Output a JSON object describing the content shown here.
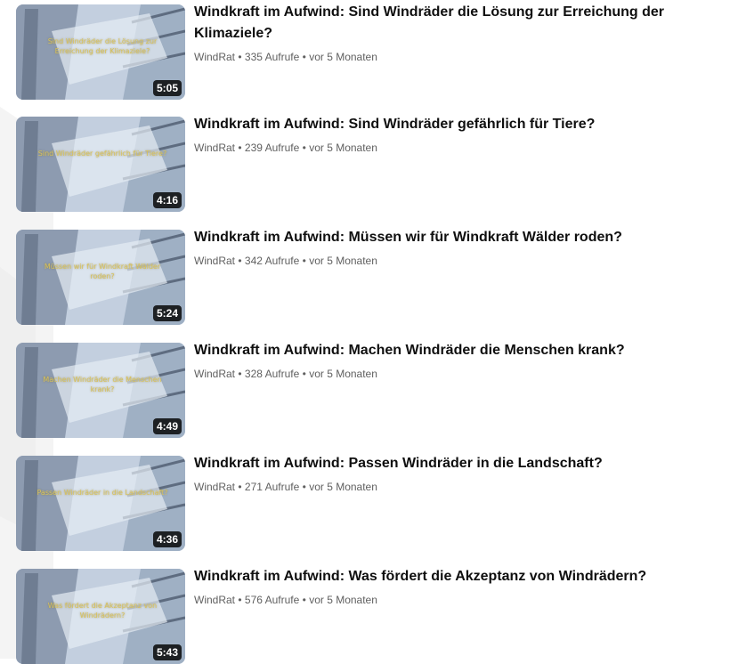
{
  "videos": [
    {
      "title": "Windkraft im Aufwind: Sind Windräder die Lösung zur Erreichung der Klimaziele?",
      "thumb_text": "Sind Windräder die Lösung zur Erreichung der Klimaziele?",
      "duration": "5:05",
      "channel": "WindRat",
      "sep1": "•",
      "views": "335 Aufrufe",
      "sep2": "•",
      "age": "vor 5 Monaten"
    },
    {
      "title": "Windkraft im Aufwind: Sind Windräder gefährlich für Tiere?",
      "thumb_text": "Sind Windräder gefährlich für Tiere?",
      "duration": "4:16",
      "channel": "WindRat",
      "sep1": "•",
      "views": "239 Aufrufe",
      "sep2": "•",
      "age": "vor 5 Monaten"
    },
    {
      "title": "Windkraft im Aufwind: Müssen wir für Windkraft Wälder roden?",
      "thumb_text": "Müssen wir für Windkraft Wälder roden?",
      "duration": "5:24",
      "channel": "WindRat",
      "sep1": "•",
      "views": "342 Aufrufe",
      "sep2": "•",
      "age": "vor 5 Monaten"
    },
    {
      "title": "Windkraft im Aufwind: Machen Windräder die Menschen krank?",
      "thumb_text": "Machen Windräder die Menschen krank?",
      "duration": "4:49",
      "channel": "WindRat",
      "sep1": "•",
      "views": "328 Aufrufe",
      "sep2": "•",
      "age": "vor 5 Monaten"
    },
    {
      "title": "Windkraft im Aufwind: Passen Windräder in die Landschaft?",
      "thumb_text": "Passen Windräder in die Landschaft?",
      "duration": "4:36",
      "channel": "WindRat",
      "sep1": "•",
      "views": "271 Aufrufe",
      "sep2": "•",
      "age": "vor 5 Monaten"
    },
    {
      "title": "Windkraft im Aufwind: Was fördert die Akzeptanz von Windrädern?",
      "thumb_text": "Was fördert die Akzeptanz von Windrädern?",
      "duration": "5:43",
      "channel": "WindRat",
      "sep1": "•",
      "views": "576 Aufrufe",
      "sep2": "•",
      "age": "vor 5 Monaten"
    }
  ]
}
